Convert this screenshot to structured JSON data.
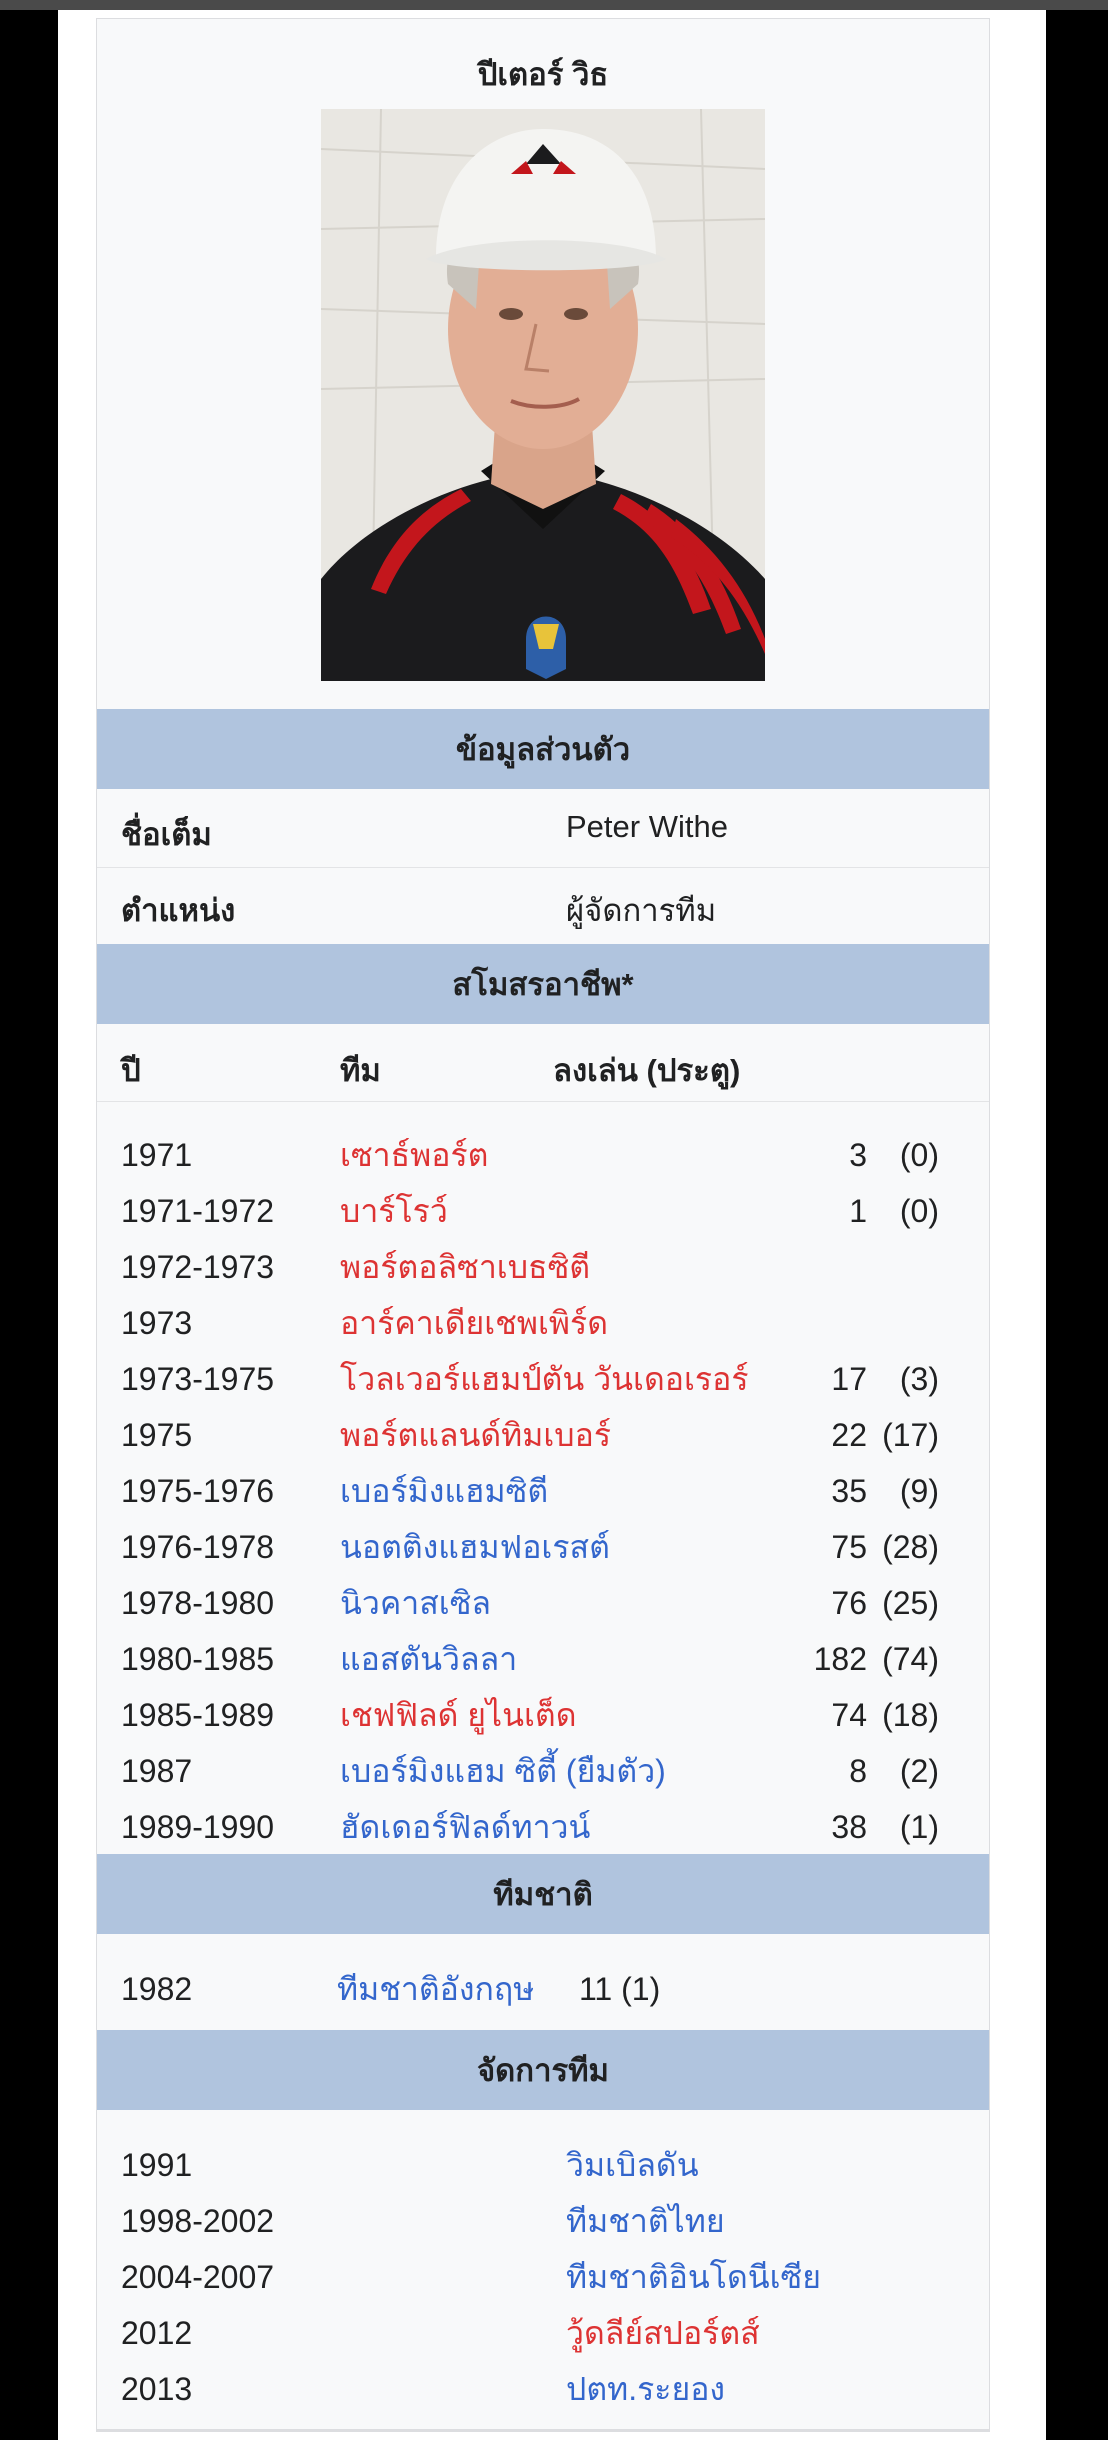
{
  "infobox": {
    "title": "ปีเตอร์ วิธ",
    "personal": {
      "heading": "ข้อมูลส่วนตัว",
      "full_name_label": "ชื่อเต็ม",
      "full_name_value": "Peter Withe",
      "position_label": "ตำแหน่ง",
      "position_value": "ผู้จัดการทีม"
    },
    "clubs": {
      "heading": "สโมสรอาชีพ*",
      "col_year": "ปี",
      "col_team": "ทีม",
      "col_apps": "ลงเล่น (ประตู)",
      "rows": [
        {
          "year": "1971",
          "team": "เซาธ์พอร์ต",
          "apps": "3",
          "goals": "(0)",
          "link": "red"
        },
        {
          "year": "1971-1972",
          "team": "บาร์โรว์",
          "apps": "1",
          "goals": "(0)",
          "link": "red"
        },
        {
          "year": "1972-1973",
          "team": "พอร์ตอลิซาเบธซิตี",
          "apps": "",
          "goals": "",
          "link": "red"
        },
        {
          "year": "1973",
          "team": "อาร์คาเดียเชพเพิร์ด",
          "apps": "",
          "goals": "",
          "link": "red"
        },
        {
          "year": "1973-1975",
          "team": "โวลเวอร์แฮมป์ตัน วันเดอเรอร์",
          "apps": "17",
          "goals": "(3)",
          "link": "red"
        },
        {
          "year": "1975",
          "team": "พอร์ตแลนด์ทิมเบอร์",
          "apps": "22",
          "goals": "(17)",
          "link": "red"
        },
        {
          "year": "1975-1976",
          "team": "เบอร์มิงแฮมซิตี",
          "apps": "35",
          "goals": "(9)",
          "link": "blue"
        },
        {
          "year": "1976-1978",
          "team": "นอตติงแฮมฟอเรสต์",
          "apps": "75",
          "goals": "(28)",
          "link": "blue"
        },
        {
          "year": "1978-1980",
          "team": "นิวคาสเซิล",
          "apps": "76",
          "goals": "(25)",
          "link": "blue"
        },
        {
          "year": "1980-1985",
          "team": "แอสตันวิลลา",
          "apps": "182",
          "goals": "(74)",
          "link": "blue"
        },
        {
          "year": "1985-1989",
          "team": "เชฟฟิลด์ ยูไนเต็ด",
          "apps": "74",
          "goals": "(18)",
          "link": "red"
        },
        {
          "year": "1987",
          "team": "เบอร์มิงแฮม ซิตี้ (ยืมตัว)",
          "apps": "8",
          "goals": "(2)",
          "link": "blue"
        },
        {
          "year": "1989-1990",
          "team": "ฮัดเดอร์ฟิลด์ทาวน์",
          "apps": "38",
          "goals": "(1)",
          "link": "blue"
        }
      ]
    },
    "national": {
      "heading": "ทีมชาติ",
      "year": "1982",
      "team": "ทีมชาติอังกฤษ",
      "apps": "11 (1)"
    },
    "managed": {
      "heading": "จัดการทีม",
      "rows": [
        {
          "year": "1991",
          "team": "วิมเบิลดัน",
          "link": "blue"
        },
        {
          "year": "1998-2002",
          "team": "ทีมชาติไทย",
          "link": "blue"
        },
        {
          "year": "2004-2007",
          "team": "ทีมชาติอินโดนีเซีย",
          "link": "blue"
        },
        {
          "year": "2012",
          "team": "วู้ดลีย์สปอร์ตส์",
          "link": "red"
        },
        {
          "year": "2013",
          "team": "ปตท.ระยอง",
          "link": "blue"
        }
      ]
    }
  },
  "colors": {
    "section_bg": "#b0c4de",
    "link_blue": "#3366cc",
    "link_red": "#dd3333"
  }
}
